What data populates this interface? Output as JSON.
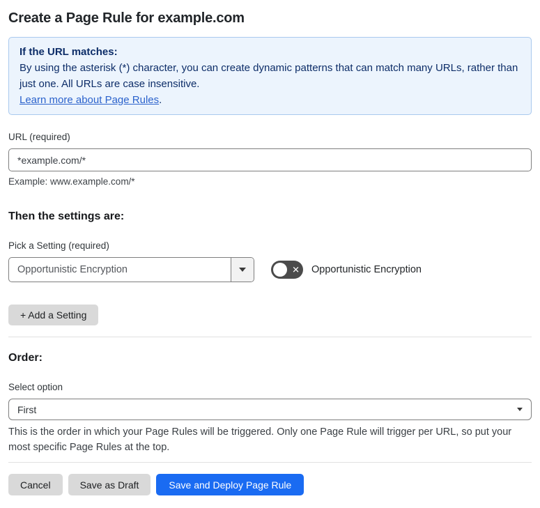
{
  "page": {
    "title": "Create a Page Rule for example.com"
  },
  "info_box": {
    "heading": "If the URL matches:",
    "body": "By using the asterisk (*) character, you can create dynamic patterns that can match many URLs, rather than just one. All URLs are case insensitive.",
    "link_text": "Learn more about Page Rules",
    "link_suffix": ".",
    "background_color": "#ecf4fd",
    "border_color": "#a9c9ee",
    "text_color": "#0d2d68",
    "link_color": "#2b62cc"
  },
  "url_field": {
    "label": "URL (required)",
    "value": "*example.com/*",
    "example": "Example: www.example.com/*"
  },
  "settings_section": {
    "heading": "Then the settings are:",
    "picker_label": "Pick a Setting (required)",
    "selected_setting": "Opportunistic Encryption",
    "dropdown_icon": "caret-down",
    "toggle": {
      "state": "off",
      "icon": "x",
      "glyph": "✕",
      "label": "Opportunistic Encryption",
      "track_color": "#4b4b4b"
    },
    "add_setting_label": "+ Add a Setting"
  },
  "order_section": {
    "heading": "Order:",
    "select_label": "Select option",
    "selected_option": "First",
    "dropdown_icon": "caret-down",
    "hint": "This is the order in which your Page Rules will be triggered. Only one Page Rule will trigger per URL, so put your most specific Page Rules at the top."
  },
  "actions": {
    "cancel_label": "Cancel",
    "save_draft_label": "Save as Draft",
    "deploy_label": "Save and Deploy Page Rule",
    "primary_color": "#1a6bf2",
    "secondary_color": "#d9d9d9"
  }
}
